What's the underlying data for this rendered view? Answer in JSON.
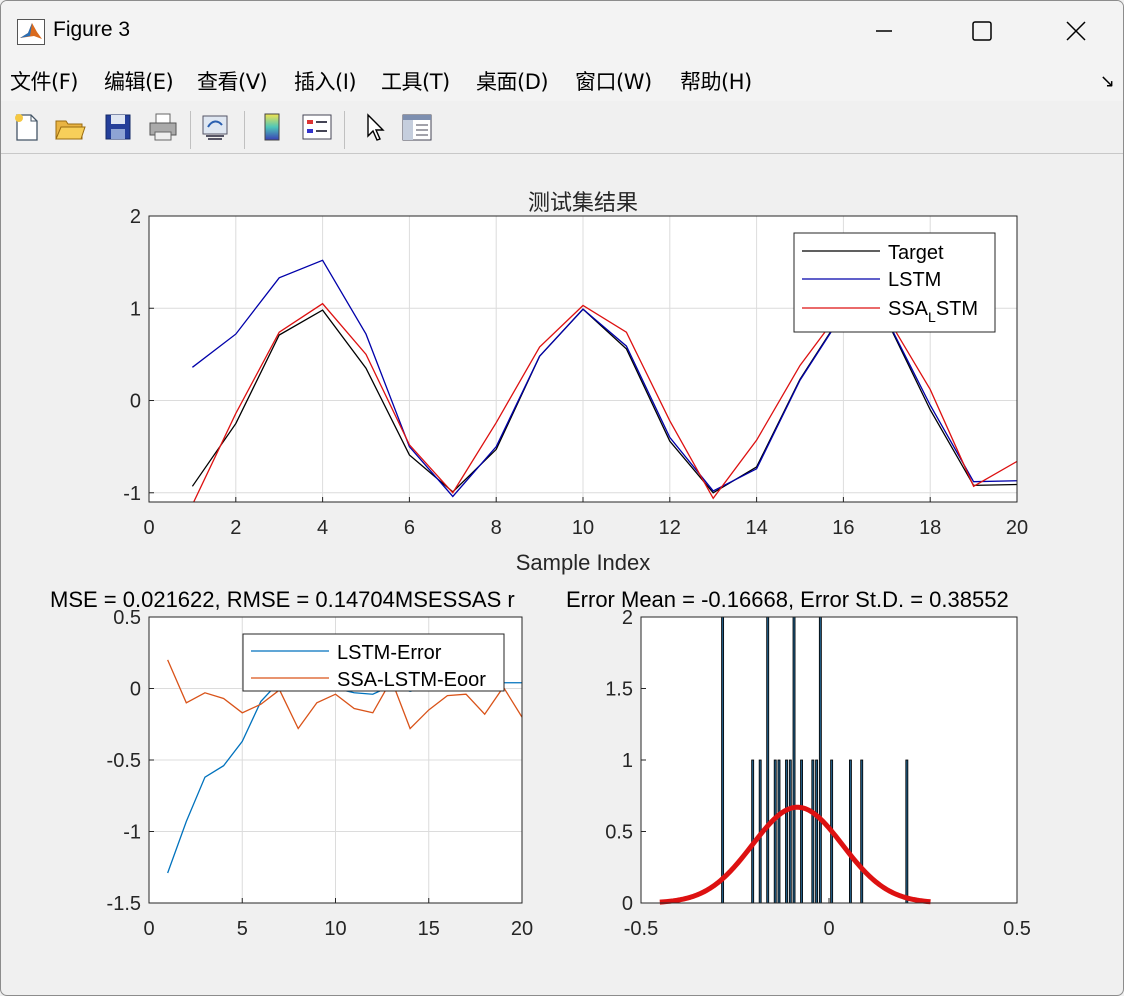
{
  "window": {
    "title": "Figure 3"
  },
  "menu": [
    "文件(F)",
    "编辑(E)",
    "查看(V)",
    "插入(I)",
    "工具(T)",
    "桌面(D)",
    "窗口(W)",
    "帮助(H)"
  ],
  "toolbar": {
    "icons": [
      "new-figure-icon",
      "open-file-icon",
      "save-icon",
      "print-icon",
      "link-plot-icon",
      "colorbar-icon",
      "legend-icon",
      "pointer-icon",
      "property-inspector-icon"
    ]
  },
  "chart_data": [
    {
      "type": "line",
      "title": "测试集结果",
      "xlabel": "Sample Index",
      "ylabel": "",
      "xlim": [
        0,
        20
      ],
      "ylim": [
        -1.1,
        2
      ],
      "xticks": [
        "0",
        "2",
        "4",
        "6",
        "8",
        "10",
        "12",
        "14",
        "16",
        "18",
        "20"
      ],
      "yticks": [
        "-1",
        "0",
        "1",
        "2"
      ],
      "grid": true,
      "legend_position": "top-right",
      "x": [
        1,
        2,
        3,
        4,
        5,
        6,
        7,
        8,
        9,
        10,
        11,
        12,
        13,
        14,
        15,
        16,
        17,
        18,
        19,
        20
      ],
      "series": [
        {
          "name": "Target",
          "color": "#000000",
          "values": [
            -0.93,
            -0.25,
            0.71,
            0.98,
            0.35,
            -0.59,
            -0.99,
            -0.53,
            0.48,
            0.99,
            0.56,
            -0.44,
            -1.0,
            -0.72,
            0.23,
            0.96,
            0.87,
            -0.1,
            -0.92,
            -0.91
          ]
        },
        {
          "name": "LSTM",
          "color": "#0000aa",
          "values": [
            0.36,
            0.72,
            1.33,
            1.52,
            0.72,
            -0.5,
            -1.04,
            -0.5,
            0.48,
            0.99,
            0.59,
            -0.4,
            -0.98,
            -0.74,
            0.22,
            0.95,
            0.88,
            -0.05,
            -0.88,
            -0.87
          ]
        },
        {
          "name": "SSA",
          "name_sub": "L",
          "name_suffix": "STM",
          "color": "#dd1111",
          "values": [
            -1.13,
            -0.14,
            0.74,
            1.05,
            0.5,
            -0.48,
            -1.0,
            -0.24,
            0.58,
            1.03,
            0.74,
            -0.22,
            -1.06,
            -0.43,
            0.38,
            1.01,
            0.91,
            0.12,
            -0.93,
            -0.66
          ]
        }
      ]
    },
    {
      "type": "line",
      "title": "MSE = 0.021622, RMSE = 0.14704MSESSAS r",
      "xlim": [
        0,
        20
      ],
      "ylim": [
        -1.5,
        0.5
      ],
      "xticks": [
        "0",
        "5",
        "10",
        "15",
        "20"
      ],
      "yticks": [
        "-1.5",
        "-1",
        "-0.5",
        "0",
        "0.5"
      ],
      "grid": true,
      "legend_position": "top-right",
      "x": [
        1,
        2,
        3,
        4,
        5,
        6,
        7,
        8,
        9,
        10,
        11,
        12,
        13,
        14,
        15,
        16,
        17,
        18,
        19,
        20
      ],
      "series": [
        {
          "name": "LSTM-Error",
          "color": "#0072bd",
          "values": [
            -1.29,
            -0.93,
            -0.62,
            -0.54,
            -0.37,
            -0.09,
            0.05,
            0.03,
            0.0,
            0.0,
            -0.03,
            -0.04,
            0.02,
            -0.02,
            0.01,
            0.01,
            -0.01,
            0.05,
            0.04,
            0.04
          ]
        },
        {
          "name": "SSA-LSTM-Eoor",
          "color": "#d95319",
          "values": [
            0.2,
            -0.1,
            -0.03,
            -0.07,
            -0.17,
            -0.11,
            -0.01,
            -0.28,
            -0.1,
            -0.04,
            -0.14,
            -0.17,
            0.06,
            -0.28,
            -0.15,
            -0.05,
            -0.04,
            -0.18,
            0.01,
            -0.2
          ]
        }
      ]
    },
    {
      "type": "histogram",
      "title": "Error Mean = -0.16668, Error St.D. = 0.38552",
      "xlim": [
        -0.5,
        0.5
      ],
      "ylim": [
        0,
        2
      ],
      "xticks": [
        "-0.5",
        "0",
        "0.5"
      ],
      "yticks": [
        "0",
        "0.5",
        "1",
        "1.5",
        "2"
      ],
      "bar_color": "#1f5a82",
      "fit_color": "#dd1111",
      "bins": [
        {
          "center": -0.283,
          "count": 2
        },
        {
          "center": -0.203,
          "count": 1
        },
        {
          "center": -0.183,
          "count": 1
        },
        {
          "center": -0.163,
          "count": 2
        },
        {
          "center": -0.143,
          "count": 1
        },
        {
          "center": -0.133,
          "count": 1
        },
        {
          "center": -0.113,
          "count": 1
        },
        {
          "center": -0.103,
          "count": 1
        },
        {
          "center": -0.093,
          "count": 2
        },
        {
          "center": -0.073,
          "count": 1
        },
        {
          "center": -0.043,
          "count": 1
        },
        {
          "center": -0.033,
          "count": 1
        },
        {
          "center": -0.023,
          "count": 2
        },
        {
          "center": 0.007,
          "count": 1
        },
        {
          "center": 0.057,
          "count": 1
        },
        {
          "center": 0.087,
          "count": 1
        },
        {
          "center": 0.207,
          "count": 1
        }
      ],
      "fit": {
        "mean": -0.084,
        "sd": 0.12,
        "peak": 0.67,
        "x_from": -0.45,
        "x_to": 0.27
      }
    }
  ]
}
